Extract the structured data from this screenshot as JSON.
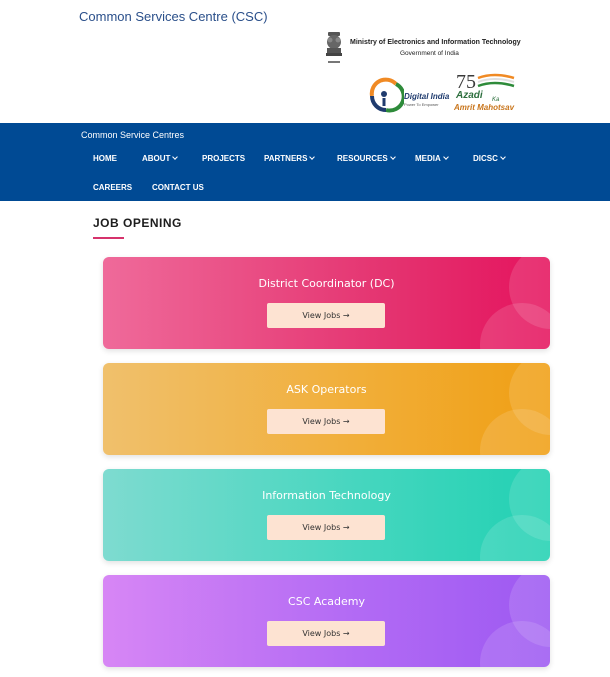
{
  "header": {
    "site_title": "Common Services Centre (CSC)",
    "ministry_line1": "Ministry of Electronics and Information Technology",
    "ministry_line2": "Government of India",
    "digital_india": "Digital India",
    "digital_india_tagline": "Power To Empower",
    "aka_line1": "Azadi",
    "aka_ka": "Ka",
    "aka_line2": "Amrit Mahotsav"
  },
  "navbar": {
    "brand": "Common Service Centres",
    "items": [
      {
        "label": "HOME"
      },
      {
        "label": "ABOUT"
      },
      {
        "label": "PROJECTS"
      },
      {
        "label": "PARTNERS"
      },
      {
        "label": "RESOURCES"
      },
      {
        "label": "MEDIA"
      },
      {
        "label": "DICSC"
      },
      {
        "label": "CAREERS"
      },
      {
        "label": "CONTACT US"
      }
    ],
    "bg_color": "#004a94"
  },
  "section": {
    "title": "JOB OPENING",
    "accent_color": "#d6336c"
  },
  "cards": [
    {
      "title": "District Coordinator (DC)",
      "button": "View Jobs →"
    },
    {
      "title": "ASK Operators",
      "button": "View Jobs →"
    },
    {
      "title": "Information Technology",
      "button": "View Jobs →"
    },
    {
      "title": "CSC Academy",
      "button": "View Jobs →"
    }
  ]
}
